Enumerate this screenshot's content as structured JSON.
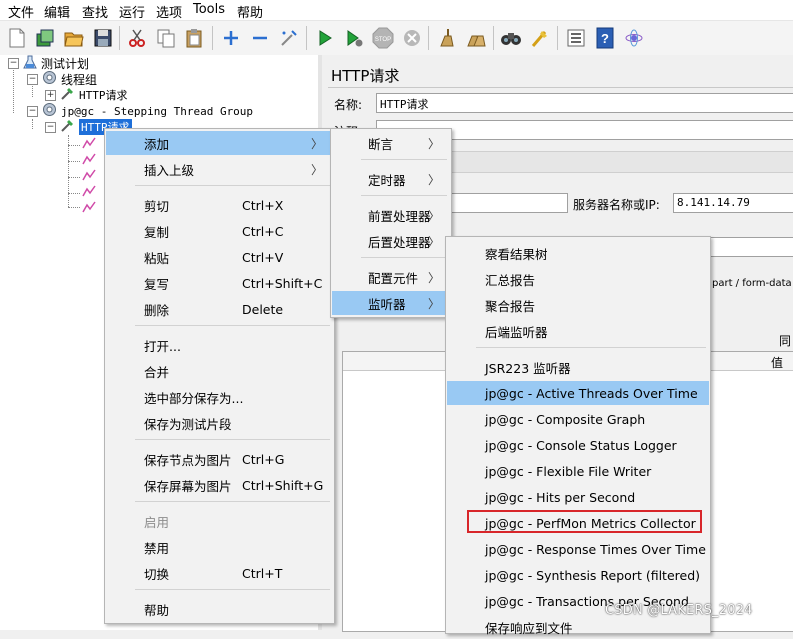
{
  "menubar": [
    "文件",
    "编辑",
    "查找",
    "运行",
    "选项",
    "Tools",
    "帮助"
  ],
  "toolbar": {
    "icons": [
      "new-icon",
      "templates-icon",
      "open-icon",
      "save-icon",
      "cut-icon",
      "copy-icon",
      "paste-icon",
      "expand-icon",
      "collapse-icon",
      "toggle-icon",
      "start-icon",
      "start-no-pause-icon",
      "stop-icon",
      "shutdown-icon",
      "clear-icon",
      "clear-all-icon",
      "search-icon",
      "reset-search-icon",
      "function-helper-icon",
      "help-icon",
      "remote-icon"
    ]
  },
  "tree": {
    "root": "测试计划",
    "thread_group": "线程组",
    "http_request_1": "HTTP请求",
    "stepping_group": "jp@gc - Stepping Thread Group",
    "http_request_selected": "HTTP请求"
  },
  "panel": {
    "title": "HTTP请求",
    "name_label": "名称:",
    "name_value": "HTTP请求",
    "comment_label": "注释:",
    "server_label": "服务器名称或IP:",
    "server_value": "8.141.14.79",
    "multipart_text": "part / form-data",
    "same_label": "同",
    "value_header": "值"
  },
  "context_menu": {
    "items": [
      {
        "label": "添加",
        "shortcut": "",
        "submenu": true
      },
      {
        "label": "插入上级",
        "shortcut": "",
        "submenu": true
      },
      {
        "label": "剪切",
        "shortcut": "Ctrl+X"
      },
      {
        "label": "复制",
        "shortcut": "Ctrl+C"
      },
      {
        "label": "粘贴",
        "shortcut": "Ctrl+V"
      },
      {
        "label": "复写",
        "shortcut": "Ctrl+Shift+C"
      },
      {
        "label": "删除",
        "shortcut": "Delete"
      },
      {
        "label": "打开...",
        "shortcut": ""
      },
      {
        "label": "合并",
        "shortcut": ""
      },
      {
        "label": "选中部分保存为...",
        "shortcut": ""
      },
      {
        "label": "保存为测试片段",
        "shortcut": ""
      },
      {
        "label": "保存节点为图片",
        "shortcut": "Ctrl+G"
      },
      {
        "label": "保存屏幕为图片",
        "shortcut": "Ctrl+Shift+G"
      },
      {
        "label": "启用",
        "shortcut": "",
        "disabled": true
      },
      {
        "label": "禁用",
        "shortcut": ""
      },
      {
        "label": "切换",
        "shortcut": "Ctrl+T"
      },
      {
        "label": "帮助",
        "shortcut": ""
      }
    ]
  },
  "add_submenu": {
    "items": [
      "断言",
      "定时器",
      "前置处理器",
      "后置处理器",
      "配置元件",
      "监听器"
    ]
  },
  "listener_submenu": {
    "items": [
      "察看结果树",
      "汇总报告",
      "聚合报告",
      "后端监听器",
      "JSR223 监听器",
      "jp@gc - Active Threads Over Time",
      "jp@gc - Composite Graph",
      "jp@gc - Console Status Logger",
      "jp@gc - Flexible File Writer",
      "jp@gc - Hits per Second",
      "jp@gc - PerfMon Metrics Collector",
      "jp@gc - Response Times Over Time",
      "jp@gc - Synthesis Report (filtered)",
      "jp@gc - Transactions per Second",
      "保存响应到文件"
    ]
  },
  "watermark": "CSDN @LAKERS_2024",
  "colors": {
    "selection": "#99c9f3",
    "tree_selection": "#1e6fd9",
    "highlight_border": "#d8262a",
    "menu_bg": "#f2f2f2"
  }
}
